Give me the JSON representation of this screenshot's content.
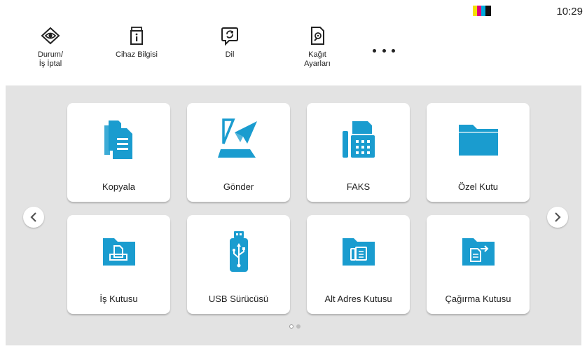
{
  "status_bar": {
    "time": "10:29",
    "toner_colors": [
      "#f5e000",
      "#e0007a",
      "#00aadd",
      "#111111"
    ]
  },
  "toolbar": {
    "items": [
      {
        "label": "Durum/\nİş İptal",
        "icon": "eye-icon"
      },
      {
        "label": "Cihaz Bilgisi",
        "icon": "device-info-icon"
      },
      {
        "label": "Dil",
        "icon": "language-icon"
      },
      {
        "label": "Kağıt\nAyarları",
        "icon": "paper-settings-icon"
      }
    ],
    "more_icon": "more-icon"
  },
  "tiles": [
    {
      "label": "Kopyala",
      "icon": "copy-icon"
    },
    {
      "label": "Gönder",
      "icon": "send-icon"
    },
    {
      "label": "FAKS",
      "icon": "fax-icon"
    },
    {
      "label": "Özel Kutu",
      "icon": "folder-icon"
    },
    {
      "label": "İş Kutusu",
      "icon": "job-box-icon"
    },
    {
      "label": "USB Sürücüsü",
      "icon": "usb-icon"
    },
    {
      "label": "Alt Adres Kutusu",
      "icon": "sub-address-box-icon"
    },
    {
      "label": "Çağırma Kutusu",
      "icon": "polling-box-icon"
    }
  ],
  "pagination": {
    "current_page": 1,
    "total_pages": 2
  },
  "colors": {
    "accent": "#1a9ccf",
    "panel_bg": "#e3e3e3",
    "tile_bg": "#ffffff"
  }
}
